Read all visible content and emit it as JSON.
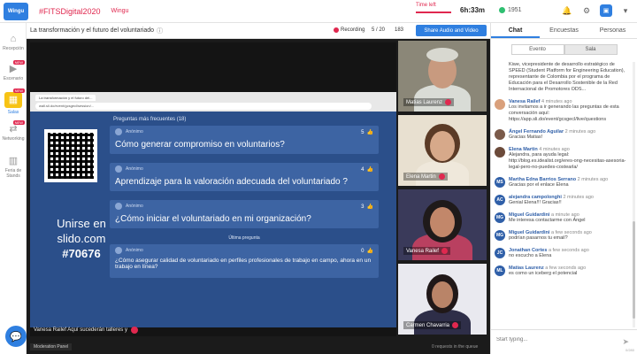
{
  "app": {
    "logo_text": "Wingu",
    "hashtag": "#FITSDigital2020",
    "brand": "Wingu"
  },
  "timer": {
    "label": "Time left",
    "value": "6h:33m"
  },
  "online": {
    "count": "1951"
  },
  "nav": {
    "items": [
      {
        "label": "Recepción",
        "icon": "home-icon"
      },
      {
        "label": "Escenario",
        "icon": "video-icon",
        "badge": "NEW"
      },
      {
        "label": "Salas",
        "icon": "rooms-icon",
        "badge": "NEW"
      },
      {
        "label": "Networking",
        "icon": "handshake-icon",
        "badge": "NEW"
      },
      {
        "label": "Feria de Stands",
        "icon": "stands-icon"
      }
    ]
  },
  "stage": {
    "title": "La transformación y el futuro del voluntariado",
    "recording": "Recording",
    "slots": "5 / 20",
    "viewers": "183",
    "share_button": "Share Audio and Video",
    "caption": "Vanesa Railef Aquí sucederán talleres y",
    "moderation": "Moderation Panel",
    "queue": "0 requests in the queue"
  },
  "browser": {
    "tab": "La transformación y el futuro del...",
    "url": "wall.sli.do/event/gcsgecl/session/..."
  },
  "slido": {
    "header": "Preguntas más frecuentes (18)",
    "join_line1": "Unirse en",
    "join_line2": "slido.com",
    "code": "#70676",
    "last_label": "Última pregunta",
    "questions": [
      {
        "author": "Anónimo",
        "votes": "5",
        "text": "Cómo generar compromiso en voluntarios?"
      },
      {
        "author": "Anónimo",
        "votes": "4",
        "text": "Aprendizaje para la valoración adecuada del voluntariado ?"
      },
      {
        "author": "Anónimo",
        "votes": "3",
        "text": "¿Cómo iniciar el voluntariado en mi organización?"
      },
      {
        "author": "Anónimo",
        "votes": "0",
        "text": "¿Cómo asegurar calidad de voluntariado en perfiles profesionales de trabajo en campo, ahora en un trabajo en línea?"
      }
    ]
  },
  "participants": [
    {
      "name": "Matias Laurenz"
    },
    {
      "name": "Elena Martin"
    },
    {
      "name": "Vanesa Railef"
    },
    {
      "name": "Carmen Chavarria"
    }
  ],
  "chat": {
    "tabs": [
      "Chat",
      "Encuestas",
      "Personas"
    ],
    "subtabs": [
      "Evento",
      "Sala"
    ],
    "intro": "Kiwe, vicepresidente de desarrollo estratégico de SPEED (Student Platform for Engineering Education), representante de Colombia por el programa de Educación para el Desarrollo Sostenible de la Red Internacional de Promotores ODS...",
    "messages": [
      {
        "initials": "",
        "name": "Vanesa Railef",
        "time": "4 minutes ago",
        "text": "Los invitamos a ir generando las preguntas de esta conversación aquí: https://app.sli.do/event/gcsgecl/live/questions"
      },
      {
        "initials": "",
        "name": "Ángel Fernando Aguilar",
        "time": "2 minutes ago",
        "text": "Gracias Matias!"
      },
      {
        "initials": "",
        "name": "Elena Martin",
        "time": "4 minutes ago",
        "text": "Alejandra, para ayuda legal: http://blog.es.idealist.org/eres-ong-necesitas-asesoria-legal-pero-no-puedes-costearla/"
      },
      {
        "initials": "MS",
        "name": "Martha Edna Barrios Serrano",
        "time": "2 minutes ago",
        "text": "Gracias por el enlace Elena"
      },
      {
        "initials": "AC",
        "name": "alejandra campolonghi",
        "time": "2 minutes ago",
        "text": "Genial Elena!!! Gracias!!"
      },
      {
        "initials": "MG",
        "name": "Miguel Guidardini",
        "time": "a minute ago",
        "text": "Me interesa contactarme con Ángel"
      },
      {
        "initials": "MG",
        "name": "Miguel Guidardini",
        "time": "a few seconds ago",
        "text": "podrían pasarnos tu email?"
      },
      {
        "initials": "JC",
        "name": "Jonathan Cortes",
        "time": "a few seconds ago",
        "text": "no escucho a Elena"
      },
      {
        "initials": "ML",
        "name": "Matias Laurenz",
        "time": "a few seconds ago",
        "text": "es como un iceberg el potencial"
      }
    ],
    "input_placeholder": "Start typing...",
    "char_count": "0/280"
  },
  "colors": {
    "accent": "#2f7fe0",
    "brand": "#e0284f",
    "slido_bg": "#2b4f8a"
  }
}
